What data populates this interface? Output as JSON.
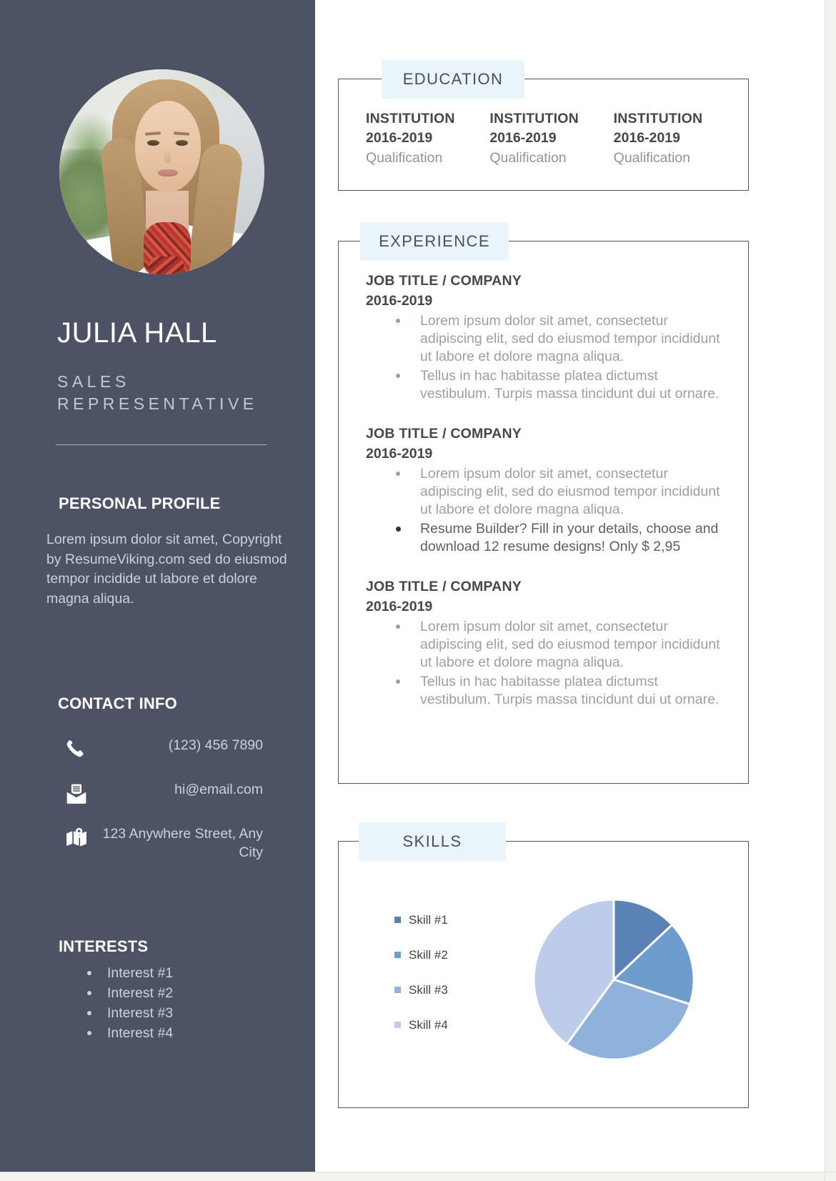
{
  "sidebar": {
    "photo_alt": "profile-photo",
    "name": "JULIA HALL",
    "role": "SALES REPRESENTATIVE",
    "profile": {
      "heading": "PERSONAL PROFILE",
      "body": "Lorem ipsum dolor sit amet, Copyright by ResumeViking.com sed do eiusmod tempor incidide ut labore et dolore magna aliqua."
    },
    "contact": {
      "heading": "CONTACT INFO",
      "items": [
        {
          "icon": "phone-icon",
          "value": "(123) 456 7890"
        },
        {
          "icon": "email-icon",
          "value": "hi@email.com"
        },
        {
          "icon": "map-location-icon",
          "value": "123 Anywhere Street, Any City"
        }
      ]
    },
    "interests": {
      "heading": "INTERESTS",
      "items": [
        "Interest #1",
        "Interest #2",
        "Interest #3",
        "Interest #4"
      ]
    }
  },
  "education": {
    "heading": "EDUCATION",
    "entries": [
      {
        "institution": "INSTITUTION",
        "years": "2016-2019",
        "qualification": "Qualification"
      },
      {
        "institution": "INSTITUTION",
        "years": "2016-2019",
        "qualification": "Qualification"
      },
      {
        "institution": "INSTITUTION",
        "years": "2016-2019",
        "qualification": "Qualification"
      }
    ]
  },
  "experience": {
    "heading": "EXPERIENCE",
    "jobs": [
      {
        "title": "JOB TITLE / COMPANY",
        "years": "2016-2019",
        "bullets": [
          {
            "text": "Lorem ipsum dolor sit amet, consectetur adipiscing elit, sed do eiusmod tempor incididunt ut labore et dolore magna aliqua.",
            "highlight": false
          },
          {
            "text": "Tellus in hac habitasse platea dictumst vestibulum. Turpis massa tincidunt dui ut ornare.",
            "highlight": false
          }
        ]
      },
      {
        "title": "JOB TITLE / COMPANY",
        "years": "2016-2019",
        "bullets": [
          {
            "text": "Lorem ipsum dolor sit amet, consectetur adipiscing elit, sed do eiusmod tempor incididunt ut labore et dolore magna aliqua.",
            "highlight": false
          },
          {
            "text": "Resume Builder? Fill in your details, choose and download 12 resume designs! Only $ 2,95",
            "highlight": true
          }
        ]
      },
      {
        "title": "JOB TITLE / COMPANY",
        "years": "2016-2019",
        "bullets": [
          {
            "text": "Lorem ipsum dolor sit amet, consectetur adipiscing elit, sed do eiusmod tempor incididunt ut labore et dolore magna aliqua.",
            "highlight": false
          },
          {
            "text": "Tellus in hac habitasse platea dictumst vestibulum. Turpis massa tincidunt dui ut ornare.",
            "highlight": false
          }
        ]
      }
    ]
  },
  "skills": {
    "heading": "SKILLS"
  },
  "chart_data": {
    "type": "pie",
    "title": "SKILLS",
    "labels": [
      "Skill #1",
      "Skill #2",
      "Skill #3",
      "Skill #4"
    ],
    "values": [
      13,
      17,
      30,
      40
    ],
    "colors": [
      "#5b82b4",
      "#6e9ccd",
      "#8fb2dc",
      "#bcccea"
    ],
    "legend_position": "left",
    "separator_color": "#ffffff"
  },
  "theme": {
    "sidebar_bg": "#4d5265",
    "badge_bg": "#eaf4fb",
    "box_border": "#50545f",
    "muted_text": "#9aa0a8",
    "dark_text": "#43474f"
  }
}
